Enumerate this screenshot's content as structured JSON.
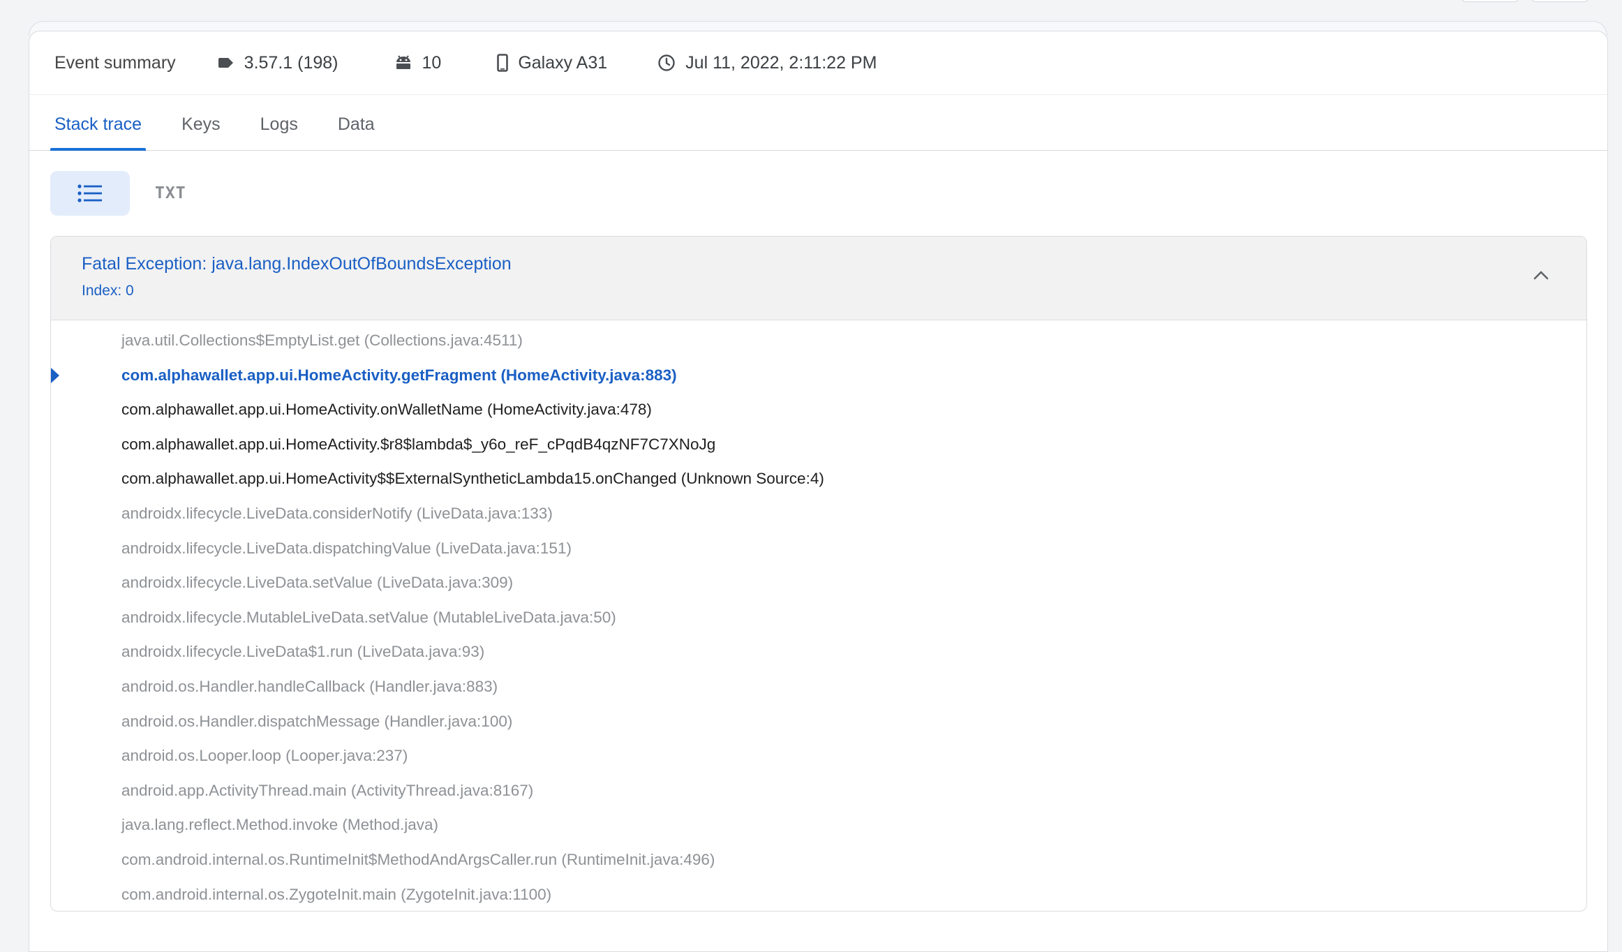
{
  "summary": {
    "title": "Event summary",
    "version": "3.57.1 (198)",
    "android_version": "10",
    "device": "Galaxy A31",
    "timestamp": "Jul 11, 2022, 2:11:22 PM"
  },
  "tabs": [
    {
      "label": "Stack trace",
      "active": true
    },
    {
      "label": "Keys",
      "active": false
    },
    {
      "label": "Logs",
      "active": false
    },
    {
      "label": "Data",
      "active": false
    }
  ],
  "view_toggle": {
    "list_icon": "list-icon",
    "txt_label": "TXT"
  },
  "exception": {
    "title": "Fatal Exception: java.lang.IndexOutOfBoundsException",
    "message": "Index: 0",
    "collapse_icon": "chevron-up-icon"
  },
  "frames": [
    {
      "text": "java.util.Collections$EmptyList.get (Collections.java:4511)",
      "kind": "library"
    },
    {
      "text": "com.alphawallet.app.ui.HomeActivity.getFragment (HomeActivity.java:883)",
      "kind": "crash"
    },
    {
      "text": "com.alphawallet.app.ui.HomeActivity.onWalletName (HomeActivity.java:478)",
      "kind": "app"
    },
    {
      "text": "com.alphawallet.app.ui.HomeActivity.$r8$lambda$_y6o_reF_cPqdB4qzNF7C7XNoJg",
      "kind": "app"
    },
    {
      "text": "com.alphawallet.app.ui.HomeActivity$$ExternalSyntheticLambda15.onChanged (Unknown Source:4)",
      "kind": "app"
    },
    {
      "text": "androidx.lifecycle.LiveData.considerNotify (LiveData.java:133)",
      "kind": "library"
    },
    {
      "text": "androidx.lifecycle.LiveData.dispatchingValue (LiveData.java:151)",
      "kind": "library"
    },
    {
      "text": "androidx.lifecycle.LiveData.setValue (LiveData.java:309)",
      "kind": "library"
    },
    {
      "text": "androidx.lifecycle.MutableLiveData.setValue (MutableLiveData.java:50)",
      "kind": "library"
    },
    {
      "text": "androidx.lifecycle.LiveData$1.run (LiveData.java:93)",
      "kind": "library"
    },
    {
      "text": "android.os.Handler.handleCallback (Handler.java:883)",
      "kind": "library"
    },
    {
      "text": "android.os.Handler.dispatchMessage (Handler.java:100)",
      "kind": "library"
    },
    {
      "text": "android.os.Looper.loop (Looper.java:237)",
      "kind": "library"
    },
    {
      "text": "android.app.ActivityThread.main (ActivityThread.java:8167)",
      "kind": "library"
    },
    {
      "text": "java.lang.reflect.Method.invoke (Method.java)",
      "kind": "library"
    },
    {
      "text": "com.android.internal.os.RuntimeInit$MethodAndArgsCaller.run (RuntimeInit.java:496)",
      "kind": "library"
    },
    {
      "text": "com.android.internal.os.ZygoteInit.main (ZygoteInit.java:1100)",
      "kind": "library"
    }
  ],
  "colors": {
    "accent": "#1a5fc4",
    "app_frame": "#1f1f1f",
    "library_frame": "#8e9195"
  }
}
